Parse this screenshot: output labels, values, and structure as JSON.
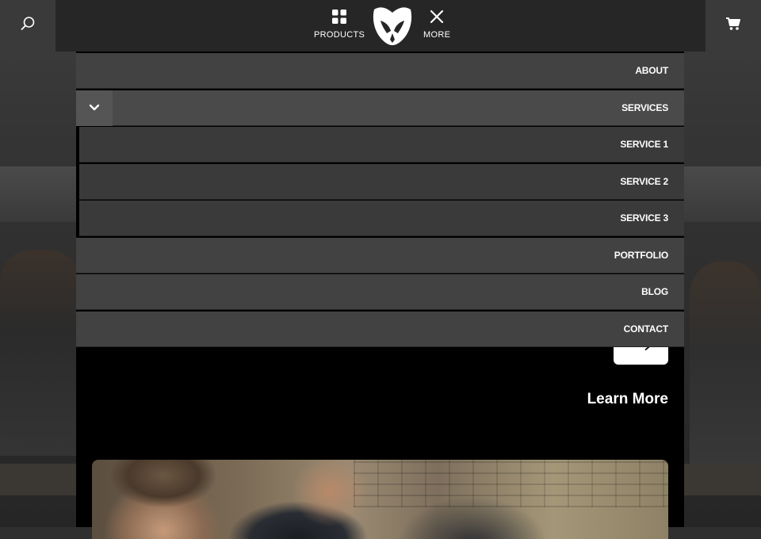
{
  "header": {
    "search_icon": "search-icon",
    "cart_icon": "cart-icon",
    "products_label": "PRODUCTS",
    "more_label": "MORE",
    "logo": "brand-logo"
  },
  "menu": {
    "items": [
      {
        "label": "ABOUT"
      },
      {
        "label": "SERVICES"
      },
      {
        "label": "SERVICE 1"
      },
      {
        "label": "SERVICE 2"
      },
      {
        "label": "SERVICE 3"
      },
      {
        "label": "PORTFOLIO"
      },
      {
        "label": "BLOG"
      },
      {
        "label": "CONTACT"
      }
    ],
    "services_toggle_icon": "chevron-down-icon"
  },
  "content": {
    "learn_more": "Learn More",
    "arrow_icon": "arrow-right-icon"
  },
  "colors": {
    "topbar": "#262626",
    "menu_bg": "#424242",
    "panel_bg": "#000000",
    "text": "#ffffff"
  }
}
